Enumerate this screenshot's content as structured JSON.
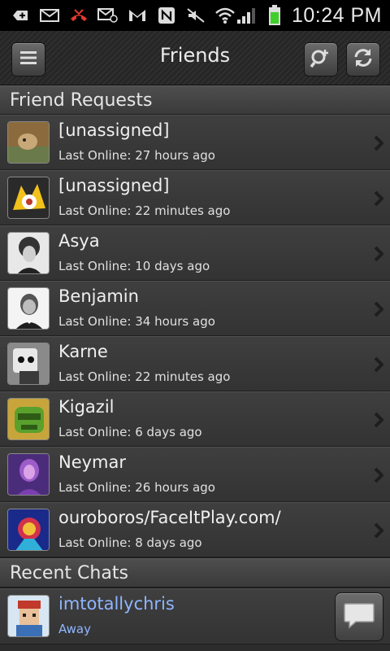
{
  "status_bar": {
    "time": "10:24 PM",
    "icons": [
      "plus-box-icon",
      "mail-icon",
      "missed-call-icon",
      "mail-at-icon",
      "gmail-icon",
      "nfc-icon",
      "mute-icon",
      "wifi-icon",
      "signal-icon",
      "battery-icon"
    ]
  },
  "header": {
    "title": "Friends",
    "menu_icon": "menu-icon",
    "search_icon": "search-add-icon",
    "refresh_icon": "refresh-icon"
  },
  "friend_requests": {
    "title": "Friend Requests",
    "items": [
      {
        "name": "[unassigned]",
        "status": "Last Online: 27 hours ago"
      },
      {
        "name": "[unassigned]",
        "status": "Last Online: 22 minutes ago"
      },
      {
        "name": "Asya",
        "status": "Last Online: 10 days ago"
      },
      {
        "name": "Benjamin",
        "status": "Last Online: 34 hours ago"
      },
      {
        "name": "Karne",
        "status": "Last Online: 22 minutes ago"
      },
      {
        "name": "Kigazil",
        "status": "Last Online: 6 days ago"
      },
      {
        "name": "Neymar",
        "status": "Last Online: 26 hours ago"
      },
      {
        "name": "ouroboros/FaceItPlay.com/",
        "status": "Last Online: 8 days ago"
      }
    ]
  },
  "recent_chats": {
    "title": "Recent Chats",
    "items": [
      {
        "name": "imtotallychris",
        "status": "Away"
      }
    ]
  },
  "colors": {
    "chat_accent": "#8fb6ff",
    "battery_green": "#3fcf2a"
  }
}
